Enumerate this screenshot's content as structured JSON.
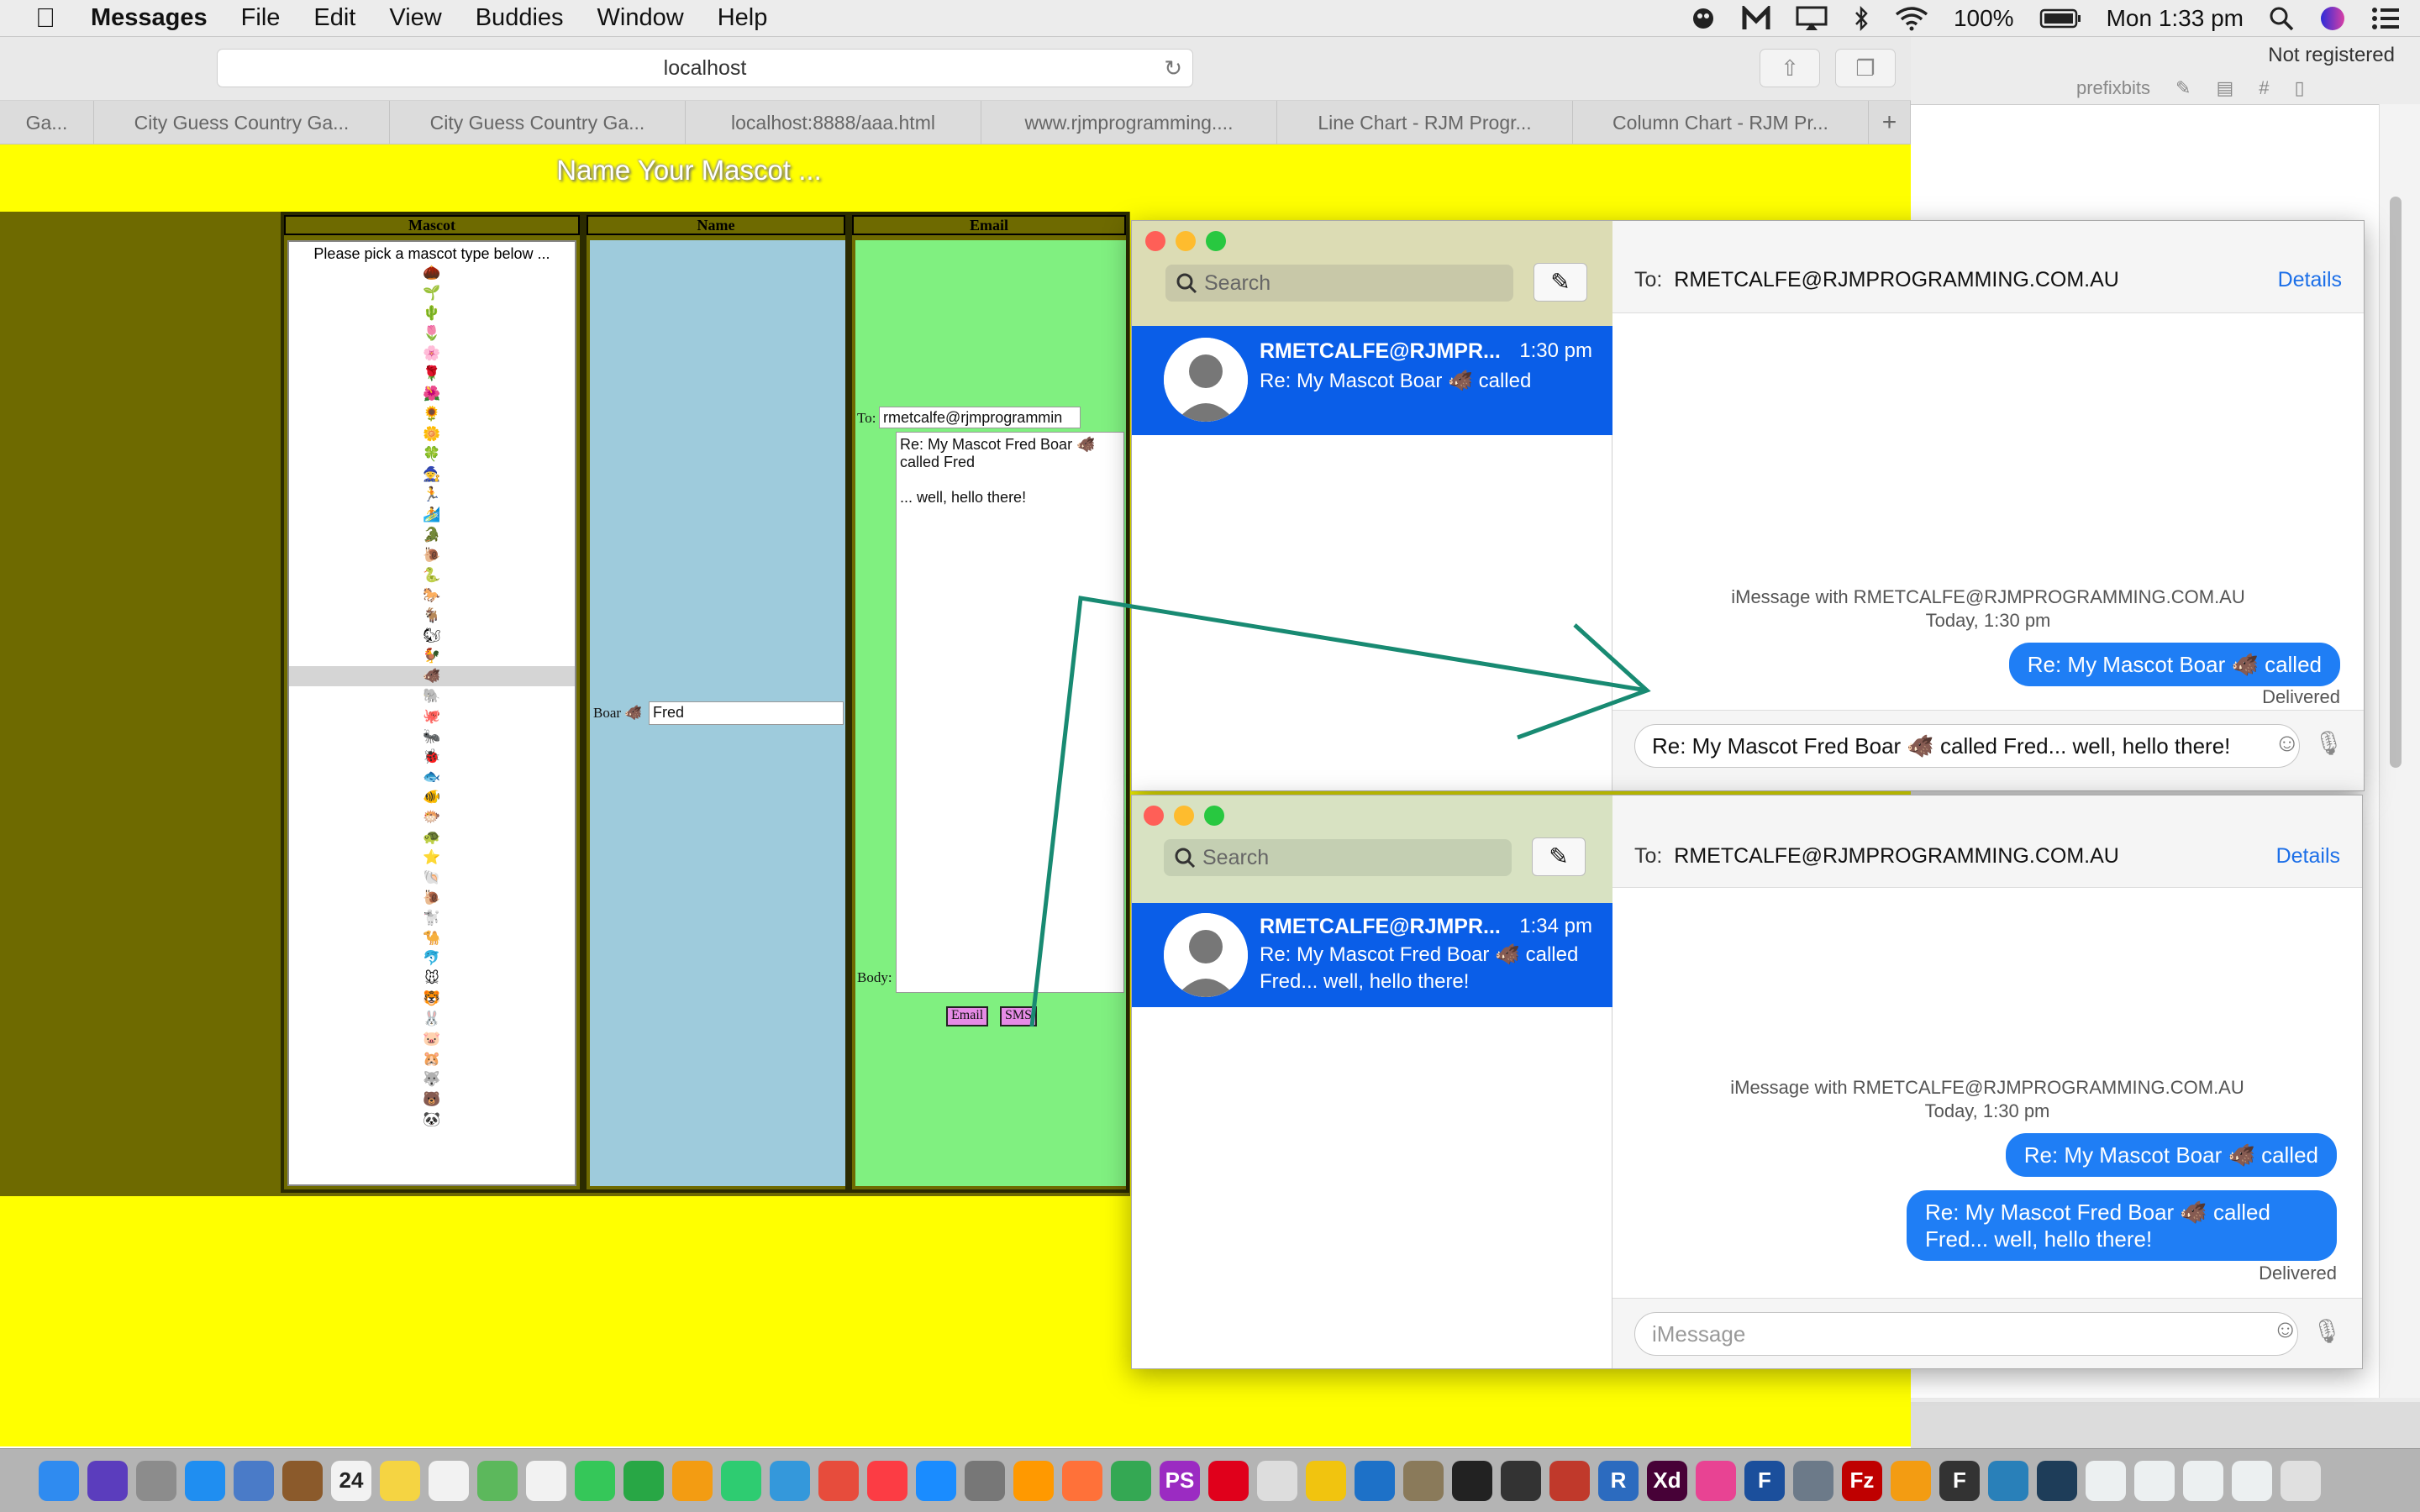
{
  "menubar": {
    "apple": "",
    "app_name": "Messages",
    "items": [
      "File",
      "Edit",
      "View",
      "Buddies",
      "Window",
      "Help"
    ],
    "battery": "100%",
    "clock": "Mon 1:33 pm"
  },
  "bg_app": {
    "not_registered": "Not registered",
    "toolbar_label": "prefixbits"
  },
  "browser": {
    "url": "localhost",
    "tabs": [
      "Ga...",
      "City Guess Country Ga...",
      "City Guess Country Ga...",
      "localhost:8888/aaa.html",
      "www.rjmprogramming....",
      "Line Chart - RJM Progr...",
      "Column Chart - RJM Pr...",
      "+"
    ]
  },
  "page": {
    "title": "Name Your Mascot ...",
    "mascot_header": "Mascot",
    "name_header": "Name",
    "email_header": "Email",
    "mascot_hint": "Please pick a mascot type below ...",
    "mascots": [
      "🌰",
      "🌱",
      "🌵",
      "🌷",
      "🌸",
      "🌹",
      "🌺",
      "🌻",
      "🌼",
      "🍀",
      "🧙",
      "🏃",
      "🏄",
      "🐊",
      "🐌",
      "🐍",
      "🐎",
      "🐐",
      "🐿",
      "🐓",
      "🐗",
      "🐘",
      "🐙",
      "🐜",
      "🐞",
      "🐟",
      "🐠",
      "🐡",
      "🐢",
      "⭐",
      "🐚",
      "🐌",
      "🐩",
      "🐪",
      "🐬",
      "🐭",
      "🐯",
      "🐰",
      "🐷",
      "🐹",
      "🐺",
      "🐻",
      "🐼"
    ],
    "selected_index": 20,
    "name_label": "Boar 🐗",
    "name_value": "Fred",
    "to_label": "To:",
    "to_value": "rmetcalfe@rjmprogrammin",
    "body_value": "Re: My Mascot Fred Boar 🐗 called Fred\n\n... well, hello there!",
    "body_label": "Body:",
    "email_button": "Email",
    "sms_button": "SMS"
  },
  "messages_top": {
    "search_placeholder": "Search",
    "conv_name": "RMETCALFE@RJMPR...",
    "conv_time": "1:30 pm",
    "conv_preview": "Re: My Mascot Boar 🐗 called",
    "to_label": "To:",
    "to_value": "RMETCALFE@RJMPROGRAMMING.COM.AU",
    "details": "Details",
    "info_line1": "iMessage with RMETCALFE@RJMPROGRAMMING.COM.AU",
    "info_line2": "Today, 1:30 pm",
    "bubble1": "Re: My Mascot Boar 🐗 called",
    "delivered": "Delivered",
    "input_value": "Re: My Mascot Fred Boar 🐗 called Fred... well, hello there!"
  },
  "messages_bottom": {
    "search_placeholder": "Search",
    "conv_name": "RMETCALFE@RJMPR...",
    "conv_time": "1:34 pm",
    "conv_preview": "Re: My Mascot Fred Boar 🐗 called Fred... well, hello there!",
    "to_label": "To:",
    "to_value": "RMETCALFE@RJMPROGRAMMING.COM.AU",
    "details": "Details",
    "info_line1": "iMessage with RMETCALFE@RJMPROGRAMMING.COM.AU",
    "info_line2": "Today, 1:30 pm",
    "bubble1": "Re: My Mascot Boar 🐗 called",
    "bubble2": "Re: My Mascot Fred Boar 🐗 called Fred... well, hello there!",
    "delivered": "Delivered",
    "input_placeholder": "iMessage"
  },
  "dock": {
    "calendar_day": "24",
    "icons": [
      {
        "name": "finder",
        "color": "#2f8bf0",
        "glyph": ""
      },
      {
        "name": "siri",
        "color": "#5b3dbd",
        "glyph": ""
      },
      {
        "name": "launchpad",
        "color": "#8c8c8c",
        "glyph": ""
      },
      {
        "name": "safari",
        "color": "#1f8ef1",
        "glyph": ""
      },
      {
        "name": "preview",
        "color": "#4a7bc8",
        "glyph": ""
      },
      {
        "name": "notebook",
        "color": "#8b5a2b",
        "glyph": ""
      },
      {
        "name": "calendar",
        "color": "#f2f2f2",
        "glyph": ""
      },
      {
        "name": "notes",
        "color": "#f5d442",
        "glyph": ""
      },
      {
        "name": "reminders",
        "color": "#f2f2f2",
        "glyph": ""
      },
      {
        "name": "maps",
        "color": "#5cb85c",
        "glyph": ""
      },
      {
        "name": "photos",
        "color": "#f2f2f2",
        "glyph": ""
      },
      {
        "name": "messages",
        "color": "#35c759",
        "glyph": ""
      },
      {
        "name": "facetime",
        "color": "#28a745",
        "glyph": ""
      },
      {
        "name": "pages",
        "color": "#f39c12",
        "glyph": ""
      },
      {
        "name": "numbers",
        "color": "#2ecc71",
        "glyph": ""
      },
      {
        "name": "keynote",
        "color": "#3498db",
        "glyph": ""
      },
      {
        "name": "news",
        "color": "#e74c3c",
        "glyph": ""
      },
      {
        "name": "music",
        "color": "#fc3c44",
        "glyph": ""
      },
      {
        "name": "app-store",
        "color": "#1a8cff",
        "glyph": ""
      },
      {
        "name": "system-preferences",
        "color": "#777777",
        "glyph": ""
      },
      {
        "name": "amazon",
        "color": "#ff9900",
        "glyph": ""
      },
      {
        "name": "firefox",
        "color": "#ff7139",
        "glyph": ""
      },
      {
        "name": "chrome",
        "color": "#34a853",
        "glyph": ""
      },
      {
        "name": "phpstorm",
        "color": "#9b2bc2",
        "glyph": "PS"
      },
      {
        "name": "opera",
        "color": "#e0001b",
        "glyph": ""
      },
      {
        "name": "sequel",
        "color": "#dddddd",
        "glyph": ""
      },
      {
        "name": "cyberduck",
        "color": "#f1c40f",
        "glyph": ""
      },
      {
        "name": "xcode",
        "color": "#1d71c8",
        "glyph": ""
      },
      {
        "name": "gimp",
        "color": "#8a7a5a",
        "glyph": ""
      },
      {
        "name": "terminal",
        "color": "#222222",
        "glyph": ""
      },
      {
        "name": "inkscape",
        "color": "#333333",
        "glyph": ""
      },
      {
        "name": "photo-booth",
        "color": "#c0392b",
        "glyph": ""
      },
      {
        "name": "r-app",
        "color": "#2c6bbf",
        "glyph": "R"
      },
      {
        "name": "adobe-xd",
        "color": "#470137",
        "glyph": "Xd"
      },
      {
        "name": "color-app",
        "color": "#e84393",
        "glyph": ""
      },
      {
        "name": "flash",
        "color": "#1b4f9c",
        "glyph": "F"
      },
      {
        "name": "server",
        "color": "#6c7a89",
        "glyph": ""
      },
      {
        "name": "filezilla",
        "color": "#bf0000",
        "glyph": "Fz"
      },
      {
        "name": "audacity",
        "color": "#f39c12",
        "glyph": ""
      },
      {
        "name": "font-app",
        "color": "#333333",
        "glyph": "F"
      },
      {
        "name": "quicktime",
        "color": "#2980b9",
        "glyph": ""
      },
      {
        "name": "book",
        "color": "#1e3d59",
        "glyph": ""
      },
      {
        "name": "folder-1",
        "color": "#ecf0f1",
        "glyph": ""
      },
      {
        "name": "folder-2",
        "color": "#ecf0f1",
        "glyph": ""
      },
      {
        "name": "folder-3",
        "color": "#ecf0f1",
        "glyph": ""
      },
      {
        "name": "folder-4",
        "color": "#ecf0f1",
        "glyph": ""
      },
      {
        "name": "trash",
        "color": "#e0e0e0",
        "glyph": ""
      }
    ]
  }
}
